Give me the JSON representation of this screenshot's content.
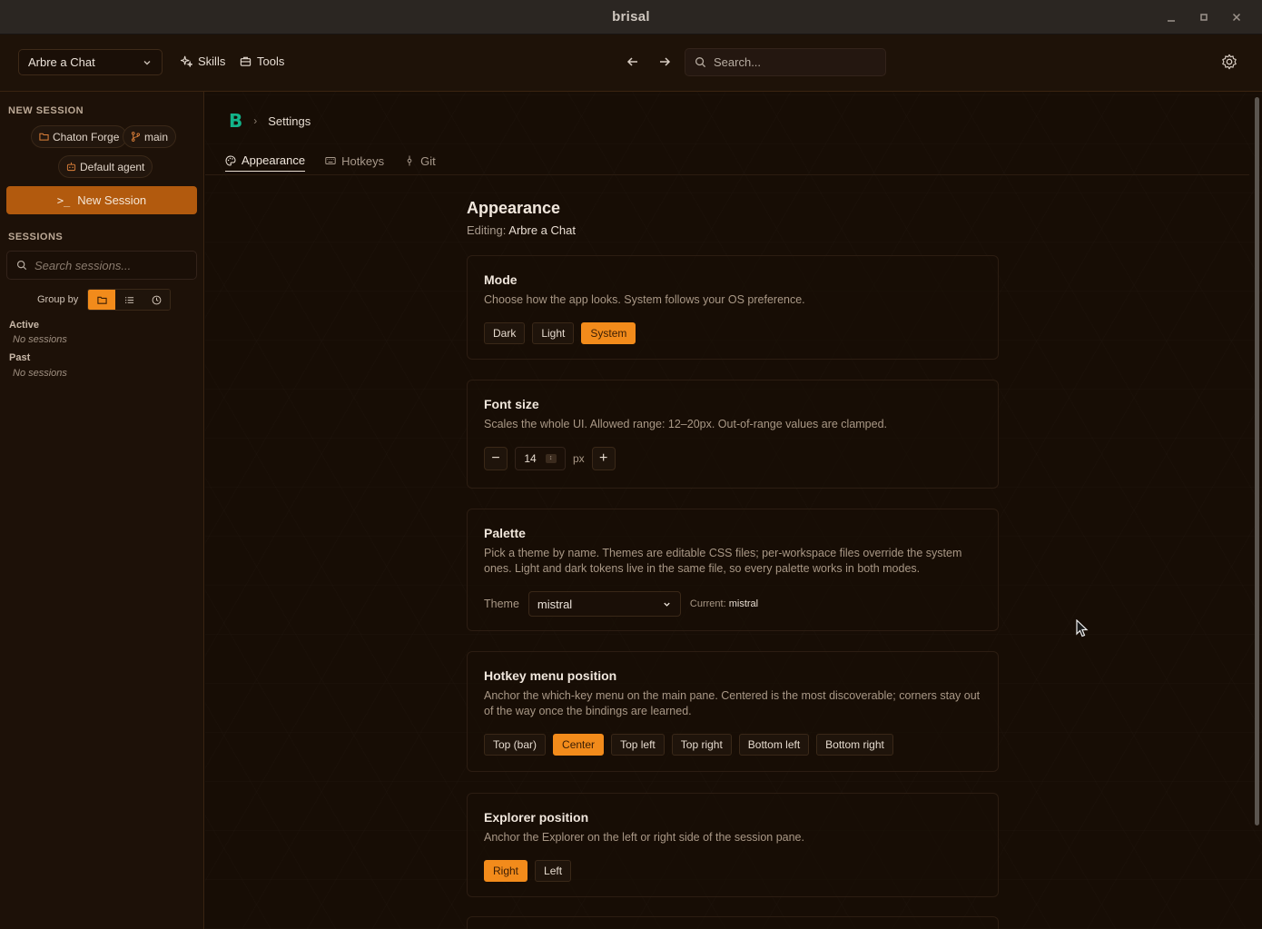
{
  "window": {
    "title": "brisal"
  },
  "topbar": {
    "workspace": "Arbre a Chat",
    "skills_label": "Skills",
    "tools_label": "Tools",
    "search_placeholder": "Search..."
  },
  "sidebar": {
    "new_session_heading": "NEW SESSION",
    "project_chip": "Chaton Forge",
    "branch_chip": "main",
    "agent_chip": "Default agent",
    "new_session_button": "New Session",
    "sessions_heading": "SESSIONS",
    "search_placeholder": "Search sessions...",
    "group_by_label": "Group by",
    "groups": [
      {
        "title": "Active",
        "empty": "No sessions"
      },
      {
        "title": "Past",
        "empty": "No sessions"
      }
    ]
  },
  "breadcrumb": {
    "logo": "B",
    "page": "Settings"
  },
  "tabs": [
    {
      "label": "Appearance",
      "icon": "palette-icon",
      "active": true
    },
    {
      "label": "Hotkeys",
      "icon": "keyboard-icon",
      "active": false
    },
    {
      "label": "Git",
      "icon": "git-commit-icon",
      "active": false
    }
  ],
  "appearance": {
    "title": "Appearance",
    "editing_label": "Editing:",
    "editing_value": "Arbre a Chat"
  },
  "mode": {
    "title": "Mode",
    "description": "Choose how the app looks. System follows your OS preference.",
    "options": [
      "Dark",
      "Light",
      "System"
    ],
    "selected": "System"
  },
  "font_size": {
    "title": "Font size",
    "description": "Scales the whole UI. Allowed range: 12–20px. Out-of-range values are clamped.",
    "value": "14",
    "unit": "px"
  },
  "palette": {
    "title": "Palette",
    "description": "Pick a theme by name. Themes are editable CSS files; per-workspace files override the system ones. Light and dark tokens live in the same file, so every palette works in both modes.",
    "theme_label": "Theme",
    "theme_value": "mistral",
    "current_label": "Current:",
    "current_value": "mistral"
  },
  "hotkey_menu": {
    "title": "Hotkey menu position",
    "description": "Anchor the which-key menu on the main pane. Centered is the most discoverable; corners stay out of the way once the bindings are learned.",
    "options": [
      "Top (bar)",
      "Center",
      "Top left",
      "Top right",
      "Bottom left",
      "Bottom right"
    ],
    "selected": "Center"
  },
  "explorer": {
    "title": "Explorer position",
    "description": "Anchor the Explorer on the left or right side of the session pane.",
    "options": [
      "Right",
      "Left"
    ],
    "selected": "Right"
  },
  "colors": {
    "accent": "#f28b1b",
    "logo": "#12b38a",
    "new_session": "#b25a0e"
  }
}
